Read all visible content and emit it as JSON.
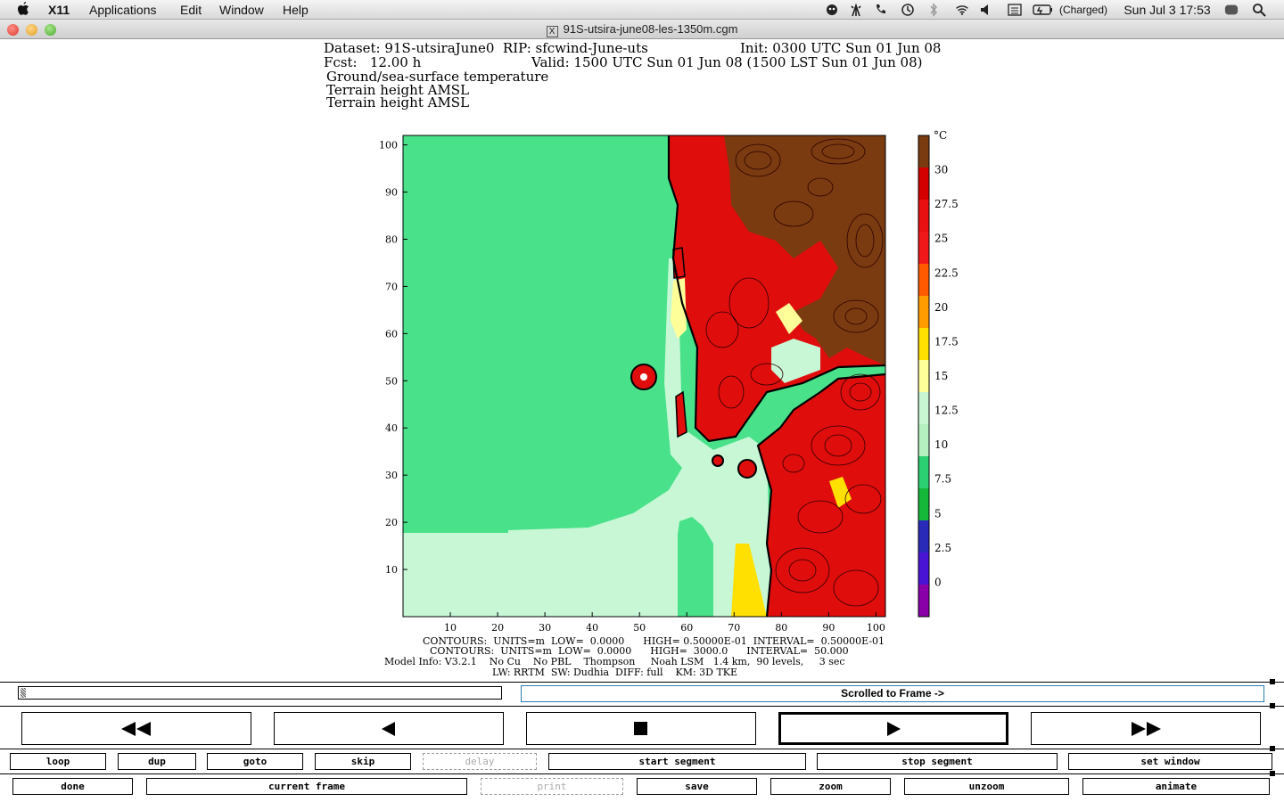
{
  "menubar": {
    "app": "X11",
    "items": [
      "Applications",
      "Edit",
      "Window",
      "Help"
    ],
    "battery": "(Charged)",
    "clock": "Sun Jul 3  17:53"
  },
  "window": {
    "title": "91S-utsira-june08-les-1350m.cgm"
  },
  "plot_header": {
    "dataset": "Dataset: 91S-utsiraJune0  RIP: sfcwind-June-uts",
    "init": "Init: 0300 UTC Sun 01 Jun 08",
    "fcst": "Fcst:   12.00 h",
    "valid": "Valid: 1500 UTC Sun 01 Jun 08 (1500 LST Sun 01 Jun 08)",
    "field1": "Ground/sea-surface temperature",
    "field2": "Terrain height AMSL",
    "field3": "Terrain height AMSL"
  },
  "plot": {
    "x_ticks": [
      "10",
      "20",
      "30",
      "40",
      "50",
      "60",
      "70",
      "80",
      "90",
      "100"
    ],
    "y_ticks": [
      "10",
      "20",
      "30",
      "40",
      "50",
      "60",
      "70",
      "80",
      "90",
      "100"
    ],
    "colorbar_unit": "°C",
    "colorbar_labels": [
      "30",
      "27.5",
      "25",
      "22.5",
      "20",
      "17.5",
      "15",
      "12.5",
      "10",
      "7.5",
      "5",
      "2.5",
      "0"
    ],
    "colorbar_colors": [
      "#7a3b10",
      "#d40000",
      "#e81010",
      "#f01818",
      "#ff5a00",
      "#ff9c00",
      "#ffe000",
      "#ffff99",
      "#c8f5d2",
      "#b4f0c0",
      "#2bd073",
      "#16b83a",
      "#2a2ab8",
      "#4a14d4",
      "#8a00a8"
    ],
    "sea_color": "#49e28a",
    "shelf_color": "#c8f7d6",
    "land_color": "#e00d0d",
    "highland_color": "#7a3b10"
  },
  "plot_footer": {
    "line1": "CONTOURS:  UNITS=m  LOW=  0.0000      HIGH= 0.50000E-01  INTERVAL=  0.50000E-01",
    "line2": "CONTOURS:  UNITS=m  LOW=  0.0000      HIGH=  3000.0      INTERVAL=  50.000",
    "line3": "Model Info: V3.2.1    No Cu    No PBL    Thompson     Noah LSM   1.4 km,  90 levels,     3 sec",
    "line4": "LW: RRTM  SW: Dudhia  DIFF: full    KM: 3D TKE"
  },
  "controls": {
    "status": "Scrolled to Frame ->",
    "row1": [
      "loop",
      "dup",
      "goto",
      "skip",
      "delay",
      "start segment",
      "stop segment",
      "set window"
    ],
    "row2": [
      "done",
      "current frame",
      "print",
      "save",
      "zoom",
      "unzoom",
      "animate"
    ]
  }
}
